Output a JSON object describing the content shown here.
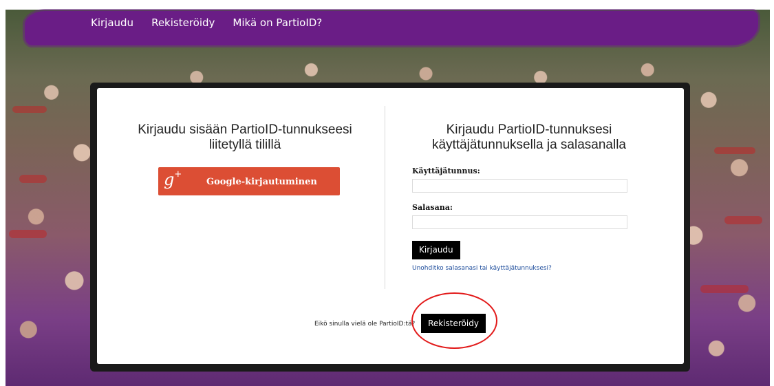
{
  "nav": {
    "items": [
      {
        "label": "Kirjaudu"
      },
      {
        "label": "Rekisteröidy"
      },
      {
        "label": "Mikä on PartioID?"
      }
    ]
  },
  "left": {
    "title_line1": "Kirjaudu sisään PartioID-tunnukseesi",
    "title_line2": "liitetyllä tilillä",
    "google_icon": "g+",
    "google_label": "Google-kirjautuminen"
  },
  "right": {
    "title_line1": "Kirjaudu PartioID-tunnuksesi",
    "title_line2": "käyttäjätunnuksella ja salasanalla",
    "username_label": "Käyttäjätunnus:",
    "username_value": "",
    "password_label": "Salasana:",
    "password_value": "",
    "login_label": "Kirjaudu",
    "forgot_label": "Unohditko salasanasi tai käyttäjätunnuksesi?"
  },
  "bottom": {
    "no_account_text": "Eikö sinulla vielä ole PartioID:tä?",
    "register_label": "Rekisteröidy"
  },
  "colors": {
    "nav_purple": "#6a1d86",
    "google_red": "#dc4e34",
    "highlight_red": "#e21a1a"
  }
}
